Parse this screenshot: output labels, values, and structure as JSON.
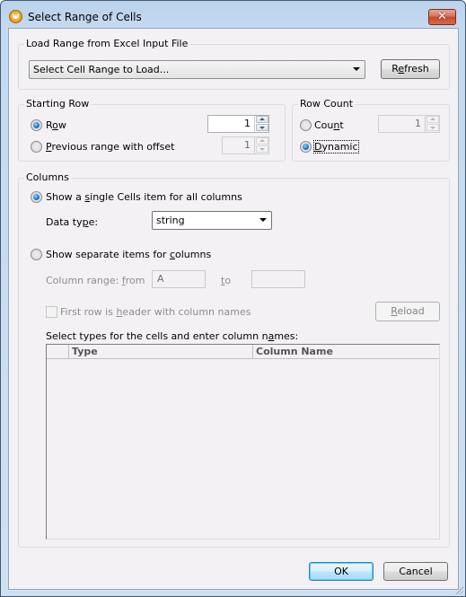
{
  "window": {
    "title": "Select Range of Cells",
    "icon": "altova-app-icon",
    "close_glyph": "✕"
  },
  "load_range": {
    "group_label": "Load Range from Excel Input File",
    "combo_value": "Select Cell Range to Load...",
    "refresh_label_pre": "R",
    "refresh_label_accel": "e",
    "refresh_label_post": "fresh"
  },
  "starting_row": {
    "group_label": "Starting Row",
    "row_option": {
      "pre": "R",
      "accel": "o",
      "post": "w",
      "checked": true
    },
    "row_value": "1",
    "prev_option": {
      "pre": "",
      "accel": "P",
      "post": "revious range with offset",
      "checked": false
    },
    "offset_value": "1"
  },
  "row_count": {
    "group_label": "Row Count",
    "count_option": {
      "pre": "Cou",
      "accel": "n",
      "post": "t",
      "checked": false
    },
    "count_value": "1",
    "dynamic_option": {
      "pre": "",
      "accel": "D",
      "post": "ynamic",
      "checked": true
    }
  },
  "columns": {
    "group_label": "Columns",
    "single_option": {
      "pre": "Show a ",
      "accel": "s",
      "post": "ingle Cells item for all columns",
      "checked": true
    },
    "data_type_label": {
      "pre": "Data ty",
      "accel": "p",
      "post": "e:"
    },
    "data_type_value": "string",
    "separate_option": {
      "pre": "Show separate items for ",
      "accel": "c",
      "post": "olumns",
      "checked": false
    },
    "column_range_label": {
      "pre": "Column range: ",
      "accel": "f",
      "post": "rom"
    },
    "from_value": "A",
    "to_label": {
      "pre": "",
      "accel": "t",
      "post": "o"
    },
    "to_value": "",
    "first_row_checkbox": {
      "pre": "First row is ",
      "accel": "h",
      "post": "eader with column names",
      "checked": false
    },
    "reload_label": {
      "pre": "",
      "accel": "R",
      "post": "eload"
    },
    "grid_caption": {
      "pre": "Select types for the cells and enter column n",
      "accel": "a",
      "post": "mes:"
    },
    "grid_headers": [
      "",
      "Type",
      "Column Name"
    ],
    "grid_rows": []
  },
  "footer": {
    "ok_label": "OK",
    "cancel_label": "Cancel"
  }
}
